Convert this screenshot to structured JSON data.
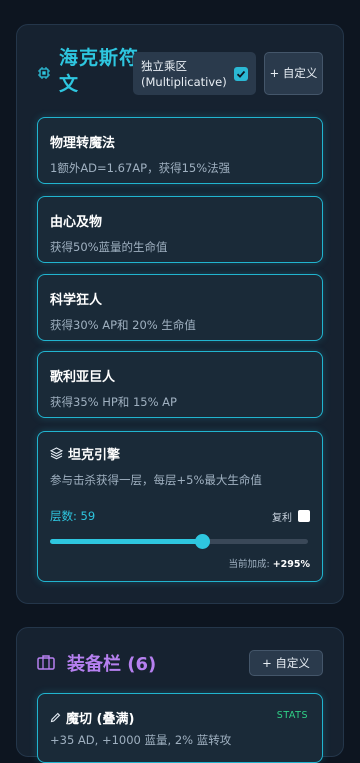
{
  "hex_panel": {
    "title": "海克斯符文",
    "mode_toggle_label": "独立乘区 (Multiplicative)",
    "mode_checked": true,
    "custom_button": "+ 自定义",
    "runes": [
      {
        "name": "物理转魔法",
        "desc": "1额外AD=1.67AP，获得15%法强"
      },
      {
        "name": "由心及物",
        "desc": "获得50%蓝量的生命值"
      },
      {
        "name": "科学狂人",
        "desc": "获得30% AP和 20% 生命值"
      },
      {
        "name": "歌利亚巨人",
        "desc": "获得35% HP和 15% AP"
      }
    ],
    "stack_rune": {
      "name": "坦克引擎",
      "desc": "参与击杀获得一层，每层+5%最大生命值",
      "stack_label": "层数: 59",
      "reset_label": "复利",
      "reset_checked": false,
      "slider_fraction": 0.59,
      "bonus_label": "当前加成:",
      "bonus_value": "+295%"
    }
  },
  "equip_panel": {
    "title": "装备栏 (6)",
    "custom_button": "+ 自定义",
    "items": [
      {
        "name": "魔切 (叠满)",
        "tag": "STATS",
        "desc": "+35 AD, +1000 蓝量, 2% 蓝转攻"
      }
    ]
  },
  "colors": {
    "accent": "#2ec6df",
    "equip_title": "#b680f0",
    "stats_tag": "#2fcf86",
    "background": "#0d1520"
  }
}
